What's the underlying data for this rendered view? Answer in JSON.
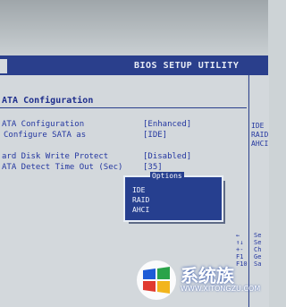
{
  "bios": {
    "title": "BIOS SETUP UTILITY",
    "section_title": "ATA Configuration",
    "settings": [
      {
        "label": "ATA Configuration",
        "value": "[Enhanced]"
      },
      {
        "label": "Configure SATA as",
        "value": "[IDE]"
      },
      {
        "label": "ard Disk Write Protect",
        "value": "[Disabled]"
      },
      {
        "label": "ATA Detect Time Out (Sec)",
        "value": "[35]"
      }
    ],
    "options_popup": {
      "title": "Options",
      "items": [
        "IDE",
        "RAID",
        "AHCI"
      ]
    },
    "help_panel": [
      "IDE",
      "RAID",
      "AHCI"
    ],
    "key_legend": [
      "←",
      "↑↓",
      "+-",
      "F1",
      "F10"
    ],
    "key_legend_desc": [
      "Se",
      "Se",
      "Ch",
      "Ge",
      "Sa"
    ]
  },
  "watermark": {
    "brand": "系统族",
    "url": "WWW.XITONGZU.COM",
    "colors": {
      "blue": "#1e5bd6",
      "red": "#e03a2f",
      "green": "#2aa34a",
      "yellow": "#f2b51d"
    }
  }
}
